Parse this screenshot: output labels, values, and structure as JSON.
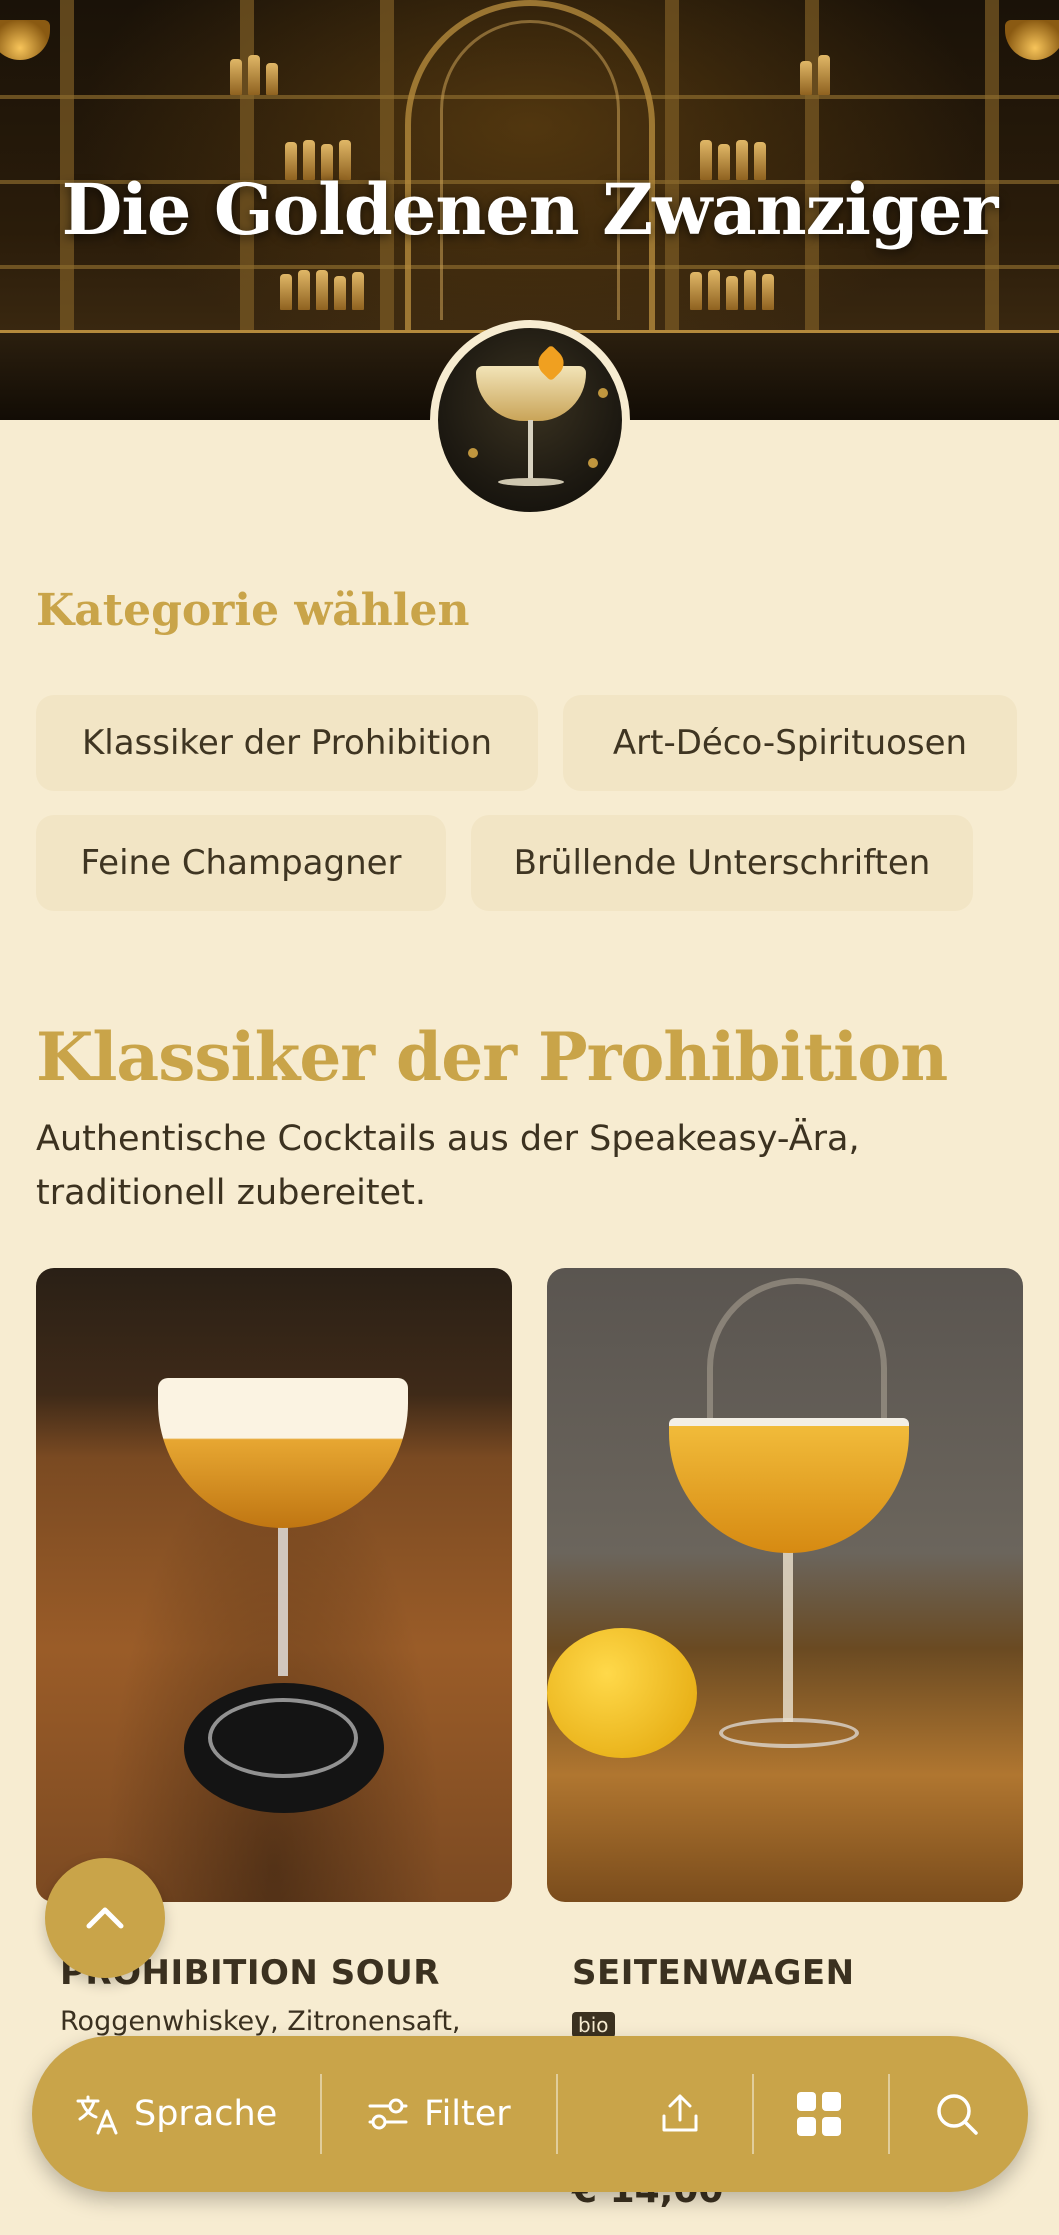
{
  "hero": {
    "title": "Die Goldenen Zwanziger"
  },
  "category": {
    "heading": "Kategorie wählen",
    "chips": [
      "Klassiker der Prohibition",
      "Art-Déco-Spirituosen",
      "Feine Champagner",
      "Brüllende Unterschriften"
    ]
  },
  "section": {
    "title": "Klassiker der Prohibition",
    "description": "Authentische Cocktails aus der Speakeasy-Ära, traditionell zubereitet."
  },
  "cards": [
    {
      "name": "PROHIBITION SOUR",
      "ingredients": "Roggenwhiskey, Zitronensaft,",
      "badge": "",
      "price": ""
    },
    {
      "name": "SEITENWAGEN",
      "ingredients": "",
      "badge": "bio",
      "price": "€ 14,00"
    }
  ],
  "bottom_bar": {
    "language_label": "Sprache",
    "filter_label": "Filter",
    "icons": [
      "translate-icon",
      "filter-icon",
      "share-icon",
      "grid-icon",
      "search-icon"
    ]
  },
  "colors": {
    "accent": "#c9a449",
    "background": "#f7ecd1",
    "chip": "#f2e5c5",
    "text": "#3c3220"
  }
}
